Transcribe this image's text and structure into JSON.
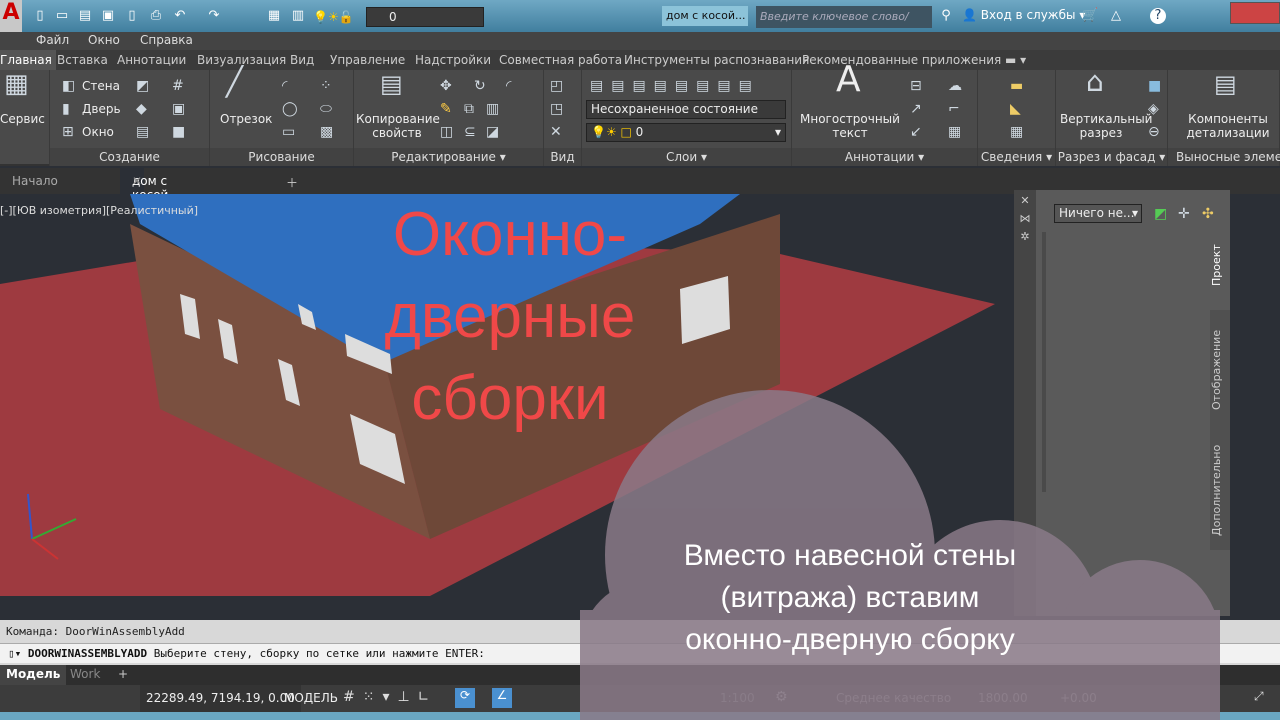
{
  "titlebar": {
    "layer_value": "0",
    "document_title": "дом с косой...",
    "search_placeholder": "Введите ключевое слово/фразу",
    "signin": "Вход в службы",
    "help": "?"
  },
  "menu": [
    "Файл",
    "Окно",
    "Справка"
  ],
  "ribbon_tabs": [
    "Главная",
    "Вставка",
    "Аннотации",
    "Визуализация",
    "Вид",
    "Управление",
    "Надстройки",
    "Совместная работа",
    "Инструменты распознавания",
    "Рекомендованные приложения"
  ],
  "ribbon": {
    "service": "Сервис",
    "create": {
      "wall": "Стена",
      "door": "Дверь",
      "window": "Окно",
      "title": "Создание"
    },
    "draw": {
      "line": "Отрезок",
      "title": "Рисование"
    },
    "modify": {
      "copy_props": "Копирование свойств",
      "title": "Редактирование"
    },
    "view": {
      "title": "Вид"
    },
    "layers": {
      "state": "Несохраненное состояние слоя",
      "layer": "0",
      "title": "Слои"
    },
    "annot": {
      "mtext": "Многострочный текст",
      "title": "Аннотации"
    },
    "info": {
      "title": "Сведения"
    },
    "section": {
      "vertical": "Вертикальный разрез",
      "title": "Разрез и фасад"
    },
    "details": {
      "components": "Компоненты детализации",
      "title": "Выносные элементы"
    }
  },
  "doc_tabs": [
    "Начало",
    "дом с косой стеной*"
  ],
  "viewport": {
    "label": "[-][ЮВ изометрия][Реалистичный]",
    "overlay_title": "Оконно-дверные сборки",
    "overlay_lines": [
      "Оконно-",
      "дверные",
      "сборки"
    ]
  },
  "palette": {
    "dropdown": "Ничего не...",
    "tabs": [
      "Проект",
      "Отображение",
      "Дополнительно"
    ]
  },
  "command": {
    "history": "Команда: DoorWinAssemblyAdd",
    "prompt_cmd": "DOORWINASSEMBLYADD",
    "prompt_text": "Выберите стену, сборку по сетке или нажмите ENTER:"
  },
  "layout_tabs": [
    "Модель",
    "Work",
    "+"
  ],
  "status": {
    "coords": "22289.49, 7194.19, 0.00",
    "model": "МОДЕЛЬ",
    "scale": "1:100",
    "quality": "Среднее качество",
    "elevation": "1800.00",
    "offset": "+0.00"
  },
  "caption": [
    "Вместо навесной стены",
    "(витража) вставим",
    "оконно-дверную сборку"
  ],
  "colors": {
    "overlay": "#f04848",
    "ground": "#9e3a40",
    "roof": "#2f6fbf",
    "wall": "#7a5040",
    "cloud": "#8a7a88"
  }
}
